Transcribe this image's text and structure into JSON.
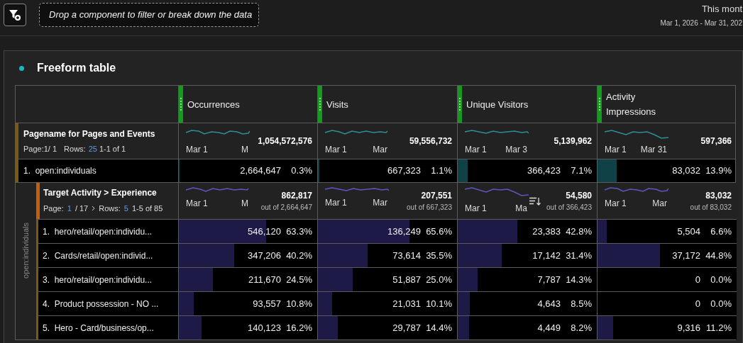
{
  "toolbar": {
    "drop_zone": "Drop a component to filter or break down the data",
    "date_label": "This mont",
    "date_range": "Mar 1, 2026 - Mar 31, 202"
  },
  "panel": {
    "title": "Freeform table",
    "columns": [
      {
        "label": "Occurrences"
      },
      {
        "label": "Visits"
      },
      {
        "label": "Unique Visitors"
      },
      {
        "label": "Activity Impressions"
      }
    ],
    "dimension": {
      "title": "Pagename for Pages and Events",
      "page_label": "Page:1/ 1",
      "rows_label": "Rows:",
      "rows_value": "25",
      "range": "1-1 of 1"
    },
    "totals": [
      {
        "value": "1,054,572,576",
        "start": "Mar 1",
        "end": "M"
      },
      {
        "value": "59,556,732",
        "start": "Mar 1",
        "end": "Mar"
      },
      {
        "value": "5,139,962",
        "start": "Mar 1",
        "end": "Mar 3"
      },
      {
        "value": "597,366",
        "start": "Mar 1",
        "end": "Mar 31"
      }
    ],
    "rows": [
      {
        "index": "1.",
        "label": "open:individuals",
        "cells": [
          {
            "value": "2,664,647",
            "percent": "0.3%",
            "level": 0.003
          },
          {
            "value": "667,323",
            "percent": "1.1%",
            "level": 0.011
          },
          {
            "value": "366,423",
            "percent": "7.1%",
            "level": 0.071
          },
          {
            "value": "83,032",
            "percent": "13.9%",
            "level": 0.139
          }
        ]
      }
    ],
    "breakdown": {
      "parent": "open:individuals",
      "title": "Target Activity > Experience",
      "page_label": "Page:",
      "page": "1",
      "page_total": "/ 17",
      "rows_label": "Rows:",
      "rows_value": "5",
      "range": "1-5 of 85",
      "totals": [
        {
          "value": "862,817",
          "out_of": "out of 2,664,647",
          "start": "Mar 1",
          "end": "M",
          "sorted": false
        },
        {
          "value": "207,551",
          "out_of": "out of 667,323",
          "start": "Mar 1",
          "end": "Mar",
          "sorted": false
        },
        {
          "value": "54,580",
          "out_of": "out of 366,423",
          "start": "Mar 1",
          "end": "Ma",
          "sorted": true
        },
        {
          "value": "83,032",
          "out_of": "out of 83,032",
          "start": "Mar 1",
          "end": "Mar",
          "sorted": false
        }
      ],
      "rows": [
        {
          "index": "1.",
          "label": "hero/retail/open:individu...",
          "cells": [
            {
              "value": "546,120",
              "percent": "63.3%",
              "level": 0.633
            },
            {
              "value": "136,249",
              "percent": "65.6%",
              "level": 0.656
            },
            {
              "value": "23,383",
              "percent": "42.8%",
              "level": 0.428
            },
            {
              "value": "5,504",
              "percent": "6.6%",
              "level": 0.066
            }
          ]
        },
        {
          "index": "2.",
          "label": "Cards/retail/open:individ...",
          "cells": [
            {
              "value": "347,206",
              "percent": "40.2%",
              "level": 0.402
            },
            {
              "value": "73,614",
              "percent": "35.5%",
              "level": 0.355
            },
            {
              "value": "17,142",
              "percent": "31.4%",
              "level": 0.314
            },
            {
              "value": "37,172",
              "percent": "44.8%",
              "level": 0.448
            }
          ]
        },
        {
          "index": "3.",
          "label": "hero/retail/open:individu...",
          "cells": [
            {
              "value": "211,670",
              "percent": "24.5%",
              "level": 0.245
            },
            {
              "value": "51,887",
              "percent": "25.0%",
              "level": 0.25
            },
            {
              "value": "7,787",
              "percent": "14.3%",
              "level": 0.143
            },
            {
              "value": "0",
              "percent": "0.0%"
            }
          ]
        },
        {
          "index": "4.",
          "label": "Product possession - NO ...",
          "cells": [
            {
              "value": "93,557",
              "percent": "10.8%",
              "level": 0.108
            },
            {
              "value": "21,031",
              "percent": "10.1%",
              "level": 0.101
            },
            {
              "value": "4,643",
              "percent": "8.5%",
              "level": 0.085
            },
            {
              "value": "0",
              "percent": "0.0%"
            }
          ]
        },
        {
          "index": "5.",
          "label": "Hero - Card/business/op...",
          "cells": [
            {
              "value": "140,123",
              "percent": "16.2%",
              "level": 0.162
            },
            {
              "value": "29,787",
              "percent": "14.4%",
              "level": 0.144
            },
            {
              "value": "4,449",
              "percent": "8.2%",
              "level": 0.082
            },
            {
              "value": "9,316",
              "percent": "11.2%",
              "level": 0.112
            }
          ]
        }
      ]
    }
  }
}
